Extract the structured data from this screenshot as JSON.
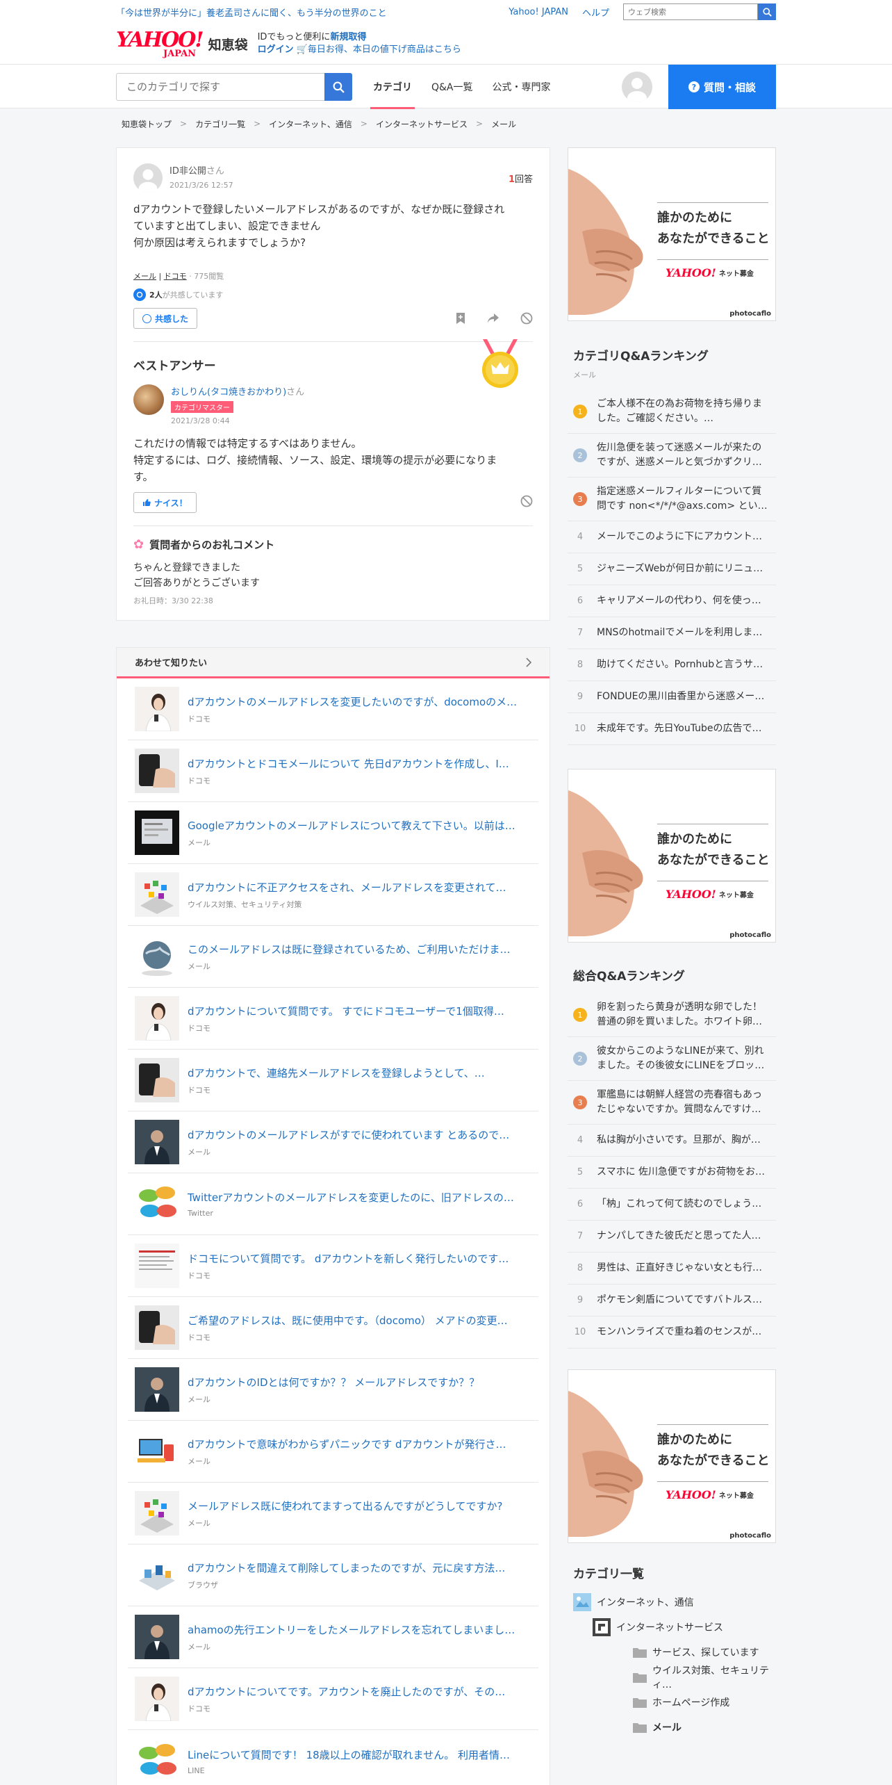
{
  "util": {
    "promo": "「今は世界が半分に」養老孟司さんに聞く、もう半分の世界のこと",
    "yahoo_japan": "Yahoo! JAPAN",
    "help": "ヘルプ",
    "search_placeholder": "ウェブ検索"
  },
  "logo": {
    "main": "YAHOO!",
    "sub": "JAPAN",
    "service": "知恵袋",
    "id_line_prefix": "IDでもっと便利に",
    "id_line_link": "新規取得",
    "login": "ログイン",
    "deal": "毎日お得、本日の値下げ商品はこちら"
  },
  "nav": {
    "search_placeholder": "このカテゴリで探す",
    "tabs": [
      "カテゴリ",
      "Q&A一覧",
      "公式・専門家"
    ],
    "ask_button": "質問・相談"
  },
  "breadcrumb": [
    "知恵袋トップ",
    "カテゴリ一覧",
    "インターネット、通信",
    "インターネットサービス",
    "メール"
  ],
  "question": {
    "user": "ID非公開",
    "san": "さん",
    "date": "2021/3/26 12:57",
    "answer_count": "1",
    "answer_label": "回答",
    "body_lines": [
      "dアカウントで登録したいメールアドレスがあるのですが、なぜか既に登録され",
      "ていますと出てしまい、設定できません",
      "何か原因は考えられますでしょうか?"
    ],
    "tags": [
      "メール",
      "ドコモ"
    ],
    "views": "775閲覧",
    "empathy_count": "2人",
    "empathy_text": "が共感しています",
    "empathy_button": "共感した"
  },
  "best_answer": {
    "title": "ベストアンサー",
    "user": "おしりん(タコ焼きおかわり)",
    "san": "さん",
    "badge": "カテゴリマスター",
    "date": "2021/3/28 0:44",
    "body_lines": [
      "これだけの情報では特定するすべはありません。",
      "特定するには、ログ、接続情報、ソース、設定、環境等の提示が必要になりま",
      "す。"
    ],
    "nice_button": "ナイス！"
  },
  "thanks": {
    "title": "質問者からのお礼コメント",
    "lines": [
      "ちゃんと登録できました",
      "ご回答ありがとうございます"
    ],
    "date": "お礼日時：3/30 22:38"
  },
  "related": {
    "title": "あわせて知りたい",
    "items": [
      {
        "title": "dアカウントのメールアドレスを変更したいのですが、docomoのメ…",
        "cat": "ドコモ",
        "thumb": "woman"
      },
      {
        "title": "dアカウントとドコモメールについて 先日dアカウントを作成し、I…",
        "cat": "ドコモ",
        "thumb": "phone"
      },
      {
        "title": "Googleアカウントのメールアドレスについて教えて下さい。以前は…",
        "cat": "メール",
        "thumb": "screen"
      },
      {
        "title": "dアカウントに不正アクセスをされ、メールアドレスを変更されて…",
        "cat": "ウイルス対策、セキュリティ対策",
        "thumb": "apps"
      },
      {
        "title": "このメールアドレスは既に登録されているため、ご利用いただけま…",
        "cat": "メール",
        "thumb": "globe"
      },
      {
        "title": "dアカウントについて質問です。 すでにドコモユーザーで1個取得…",
        "cat": "ドコモ",
        "thumb": "woman"
      },
      {
        "title": "dアカウントで、連絡先メールアドレスを登録しようとして、…",
        "cat": "ドコモ",
        "thumb": "phone"
      },
      {
        "title": "dアカウントのメールアドレスがすでに使われています とあるので…",
        "cat": "メール",
        "thumb": "suit"
      },
      {
        "title": "Twitterアカウントのメールアドレスを変更したのに、旧アドレスの…",
        "cat": "Twitter",
        "thumb": "bubbles"
      },
      {
        "title": "ドコモについて質問です。 dアカウントを新しく発行したいのです…",
        "cat": "ドコモ",
        "thumb": "doc"
      },
      {
        "title": "ご希望のアドレスは、既に使用中です。（docomo） メアドの変更…",
        "cat": "ドコモ",
        "thumb": "phone"
      },
      {
        "title": "dアカウントのIDとは何ですか？？ メールアドレスですか？？",
        "cat": "メール",
        "thumb": "suit"
      },
      {
        "title": "dアカウントで意味がわからずパニックです dアカウントが発行さ…",
        "cat": "メール",
        "thumb": "devices"
      },
      {
        "title": "メールアドレス既に使われてますって出るんですがどうしてですか?",
        "cat": "メール",
        "thumb": "apps"
      },
      {
        "title": "dアカウントを間違えて削除してしまったのですが、元に戻す方法…",
        "cat": "ブラウザ",
        "thumb": "iso"
      },
      {
        "title": "ahamoの先行エントリーをしたメールアドレスを忘れてしまいまし…",
        "cat": "メール",
        "thumb": "suit"
      },
      {
        "title": "dアカウントについてです。アカウントを廃止したのですが、その…",
        "cat": "ドコモ",
        "thumb": "woman"
      },
      {
        "title": "Lineについて質問です！ 18歳以上の確認が取れません。 利用者情…",
        "cat": "LINE",
        "thumb": "bubbles"
      }
    ]
  },
  "ad": {
    "line1": "誰かのために",
    "line2": "あなたができること",
    "brand": "YAHOO!",
    "brand_sub": "ネット募金",
    "credit": "photocaflo"
  },
  "category_ranking": {
    "title": "カテゴリQ&Aランキング",
    "sub": "メール",
    "items": [
      "ご本人様不在の為お荷物を持ち帰りました。ご確認ください。…",
      "佐川急便を装って迷惑メールが来たのですが、迷惑メールと気づかずクリ…",
      "指定迷惑メールフィルターについて質問です non<*/*/*@axs.com> という…",
      "メールでこのように下にアカウント…",
      "ジャニーズWebが何日か前にリニュ…",
      "キャリアメールの代わり、何を使っ…",
      "MNSのhotmailでメールを利用します…",
      "助けてください。Pornhubと言うサ…",
      "FONDUEの黒川由香里から迷惑メー…",
      "未成年です。先日YouTubeの広告で…"
    ]
  },
  "overall_ranking": {
    "title": "総合Q&Aランキング",
    "items": [
      "卵を割ったら黄身が透明な卵でした！普通の卵を買いました。ホワイト卵…",
      "彼女からこのようなLINEが来て、別れました。その後彼女にLINEをブロッ…",
      "軍艦島には朝鮮人経営の売春宿もあったじゃないですか。質問なんですけ…",
      "私は胸が小さいです。旦那が、胸が…",
      "スマホに 佐川急便ですがお荷物をお…",
      "「枘」これって何て読むのでしょう…",
      "ナンパしてきた彼氏だと思ってた人…",
      "男性は、正直好きじゃない女とも行…",
      "ポケモン剣盾についてですバトルス…",
      "モンハンライズで重ね着のセンスが…"
    ]
  },
  "category_list": {
    "title": "カテゴリ一覧",
    "items": [
      {
        "label": "インターネット、通信",
        "level": 0
      },
      {
        "label": "インターネットサービス",
        "level": 1
      },
      {
        "label": "サービス、探しています",
        "level": 2
      },
      {
        "label": "ウイルス対策、セキュリティ…",
        "level": 2
      },
      {
        "label": "ホームページ作成",
        "level": 2
      },
      {
        "label": "メール",
        "level": 2
      }
    ]
  },
  "colors": {
    "accent_blue": "#1a7cf0",
    "link_blue": "#1f6fbf",
    "pink": "#ff5c77",
    "rank_gold": "#f5b21b",
    "rank_silver": "#a9c2d9",
    "rank_bronze": "#e87e4e"
  }
}
